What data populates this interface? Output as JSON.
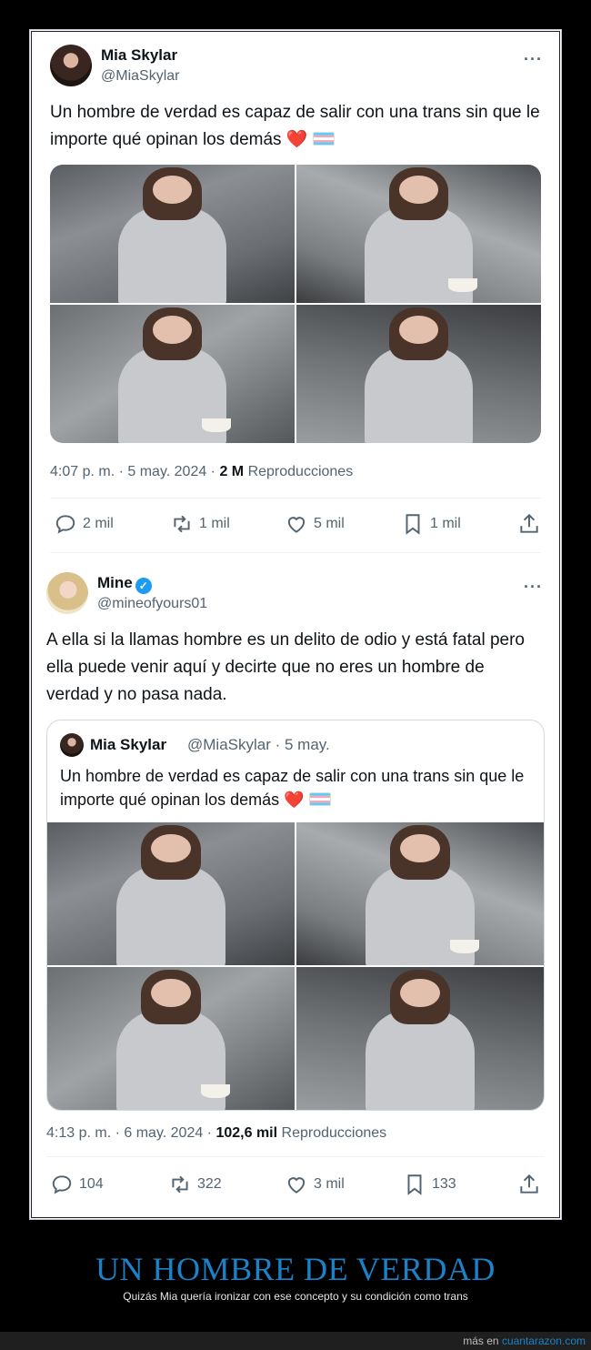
{
  "tweet1": {
    "name": "Mia Skylar",
    "handle": "@MiaSkylar",
    "text": "Un hombre de verdad es capaz de salir con una trans sin que le importe qué opinan los demás",
    "heart": "❤️",
    "time": "4:07 p. m. · 5 may. 2024 · ",
    "views": "2 M",
    "views_label": " Reproducciones",
    "replies": "2 mil",
    "retweets": "1 mil",
    "likes": "5 mil",
    "bookmarks": "1 mil",
    "photo_grid": "4 photos"
  },
  "tweet2": {
    "name": "Mine",
    "handle": "@mineofyours01",
    "text": "A ella si la llamas hombre es un delito de odio y está fatal pero ella puede venir aquí y decirte que no eres un hombre de verdad y no pasa nada.",
    "time": "4:13 p. m. · 6 may. 2024 · ",
    "views": "102,6 mil",
    "views_label": " Reproducciones",
    "replies": "104",
    "retweets": "322",
    "likes": "3 mil",
    "bookmarks": "133",
    "verified_mark": "✓"
  },
  "quoted": {
    "name": "Mia Skylar",
    "meta": "@MiaSkylar · 5 may.",
    "text": "Un hombre de verdad es capaz de salir con una trans sin que le importe qué opinan los demás",
    "heart": "❤️"
  },
  "more_glyph": "···",
  "caption": {
    "title": "UN HOMBRE DE VERDAD",
    "subtitle": "Quizás Mia quería ironizar con ese concepto y su condición como trans"
  },
  "footer": {
    "prefix": "más en ",
    "site": "cuantarazon.com"
  },
  "colors": {
    "link": "#1a82c8",
    "verified": "#1d9bf0",
    "muted": "#536471"
  }
}
